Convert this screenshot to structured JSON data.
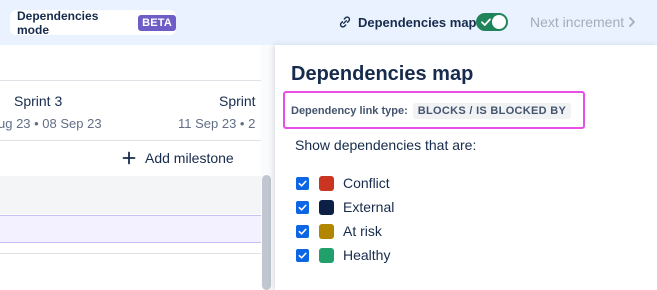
{
  "topbar": {
    "mode_label": "Dependencies mode",
    "beta_badge": "BETA",
    "map_label": "Dependencies map",
    "map_toggle_on": true,
    "next_increment_label": "Next increment"
  },
  "timeline": {
    "sprints": [
      {
        "name": "Sprint 3",
        "dates": "ug 23 • 08 Sep 23"
      },
      {
        "name": "Sprint",
        "dates": "11 Sep 23 • 2"
      }
    ],
    "add_milestone_label": "Add milestone"
  },
  "panel": {
    "title": "Dependencies map",
    "link_type_label": "Dependency link type:",
    "link_type_value": "BLOCKS / IS BLOCKED BY",
    "show_label": "Show dependencies that are:",
    "filters": [
      {
        "label": "Conflict",
        "checked": true,
        "color": "#ca3521"
      },
      {
        "label": "External",
        "checked": true,
        "color": "#0c1f45"
      },
      {
        "label": "At risk",
        "checked": true,
        "color": "#b38600"
      },
      {
        "label": "Healthy",
        "checked": true,
        "color": "#22a06b"
      }
    ]
  },
  "colors": {
    "topbar_bg": "#e9f2fe",
    "beta": "#6e5dc6",
    "toggle_on": "#1f845a",
    "checkbox": "#0c66e4",
    "highlight_border": "#e94fe6"
  }
}
